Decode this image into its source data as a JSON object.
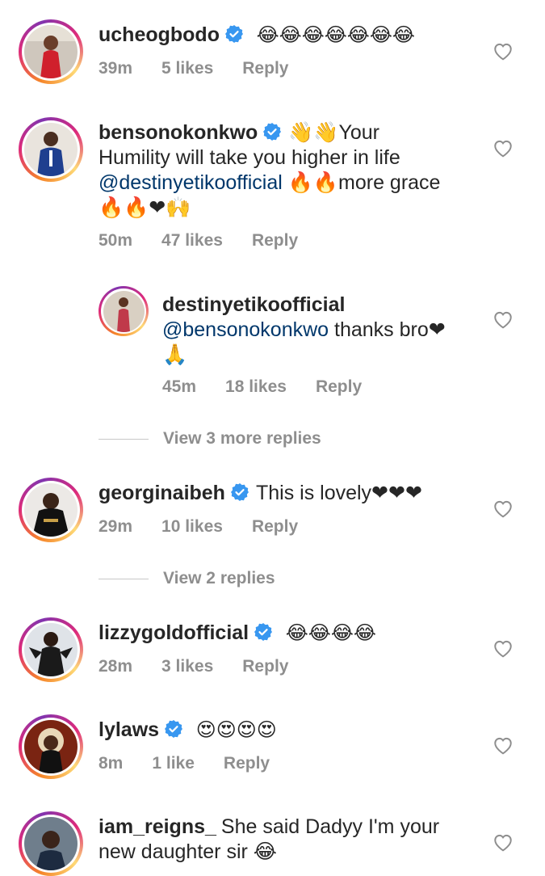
{
  "comments": [
    {
      "username": "ucheogbodo",
      "verified": true,
      "text_after": " 😂😂😂😂😂😂😂",
      "time": "39m",
      "likes": "5 likes",
      "reply": "Reply"
    },
    {
      "username": "bensonokonkwo",
      "verified": true,
      "text_lead": "👋👋Your",
      "text_line2": "Humility will take you higher in life",
      "mention": "@destinyetikoofficial",
      "text_line3_after": " 🔥🔥more grace",
      "text_line4": "🔥🔥❤🙌",
      "time": "50m",
      "likes": "47 likes",
      "reply": "Reply"
    },
    {
      "username": "destinyetikoofficial",
      "mention": "@bensonokonkwo",
      "text_after": " thanks bro❤",
      "text_line3": "🙏",
      "time": "45m",
      "likes": "18 likes",
      "reply": "Reply"
    },
    {
      "username": "georginaibeh",
      "verified": true,
      "text_after": "This is lovely❤❤❤",
      "time": "29m",
      "likes": "10 likes",
      "reply": "Reply"
    },
    {
      "username": "lizzygoldofficial",
      "verified": true,
      "text_after": " 😂😂😂😂",
      "time": "28m",
      "likes": "3 likes",
      "reply": "Reply"
    },
    {
      "username": "lylaws",
      "verified": true,
      "text_after": " 😍😍😍😍",
      "time": "8m",
      "likes": "1 like",
      "reply": "Reply"
    },
    {
      "username": "iam_reigns_",
      "text_after": "She said Dadyy I'm your",
      "text_line2": "new daughter sir 😂"
    }
  ],
  "view_more_1": "View 3 more replies",
  "view_more_2": "View 2 replies",
  "colors": {
    "text": "#262626",
    "meta": "#8e8e8e",
    "mention": "#00376b",
    "verified": "#3897f0"
  }
}
